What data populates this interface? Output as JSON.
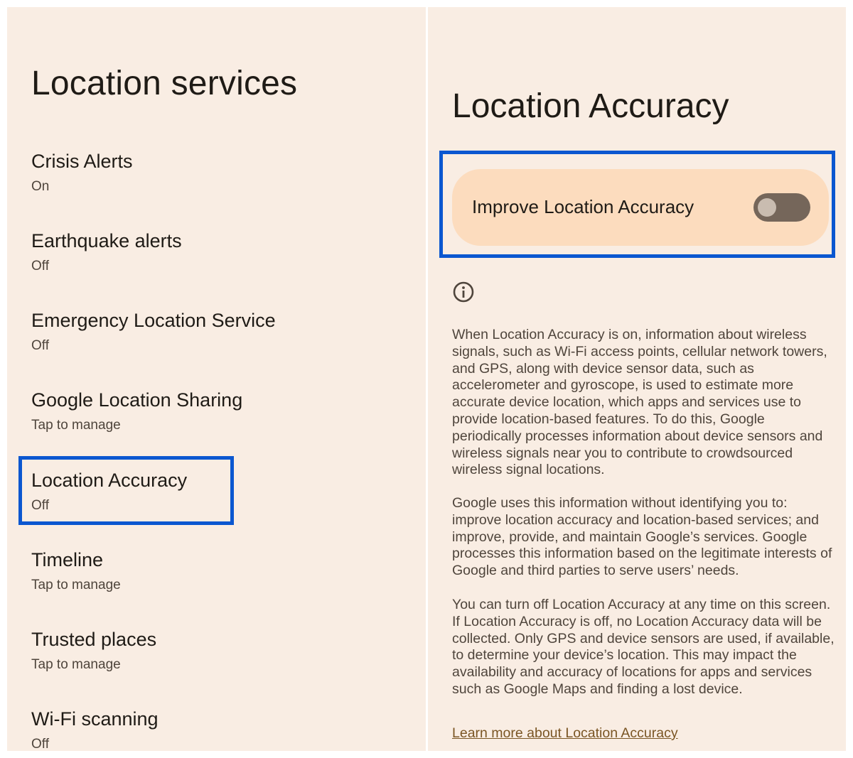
{
  "left_panel": {
    "title": "Location services",
    "items": [
      {
        "title": "Crisis Alerts",
        "subtitle": "On"
      },
      {
        "title": "Earthquake alerts",
        "subtitle": "Off"
      },
      {
        "title": "Emergency Location Service",
        "subtitle": "Off"
      },
      {
        "title": "Google Location Sharing",
        "subtitle": "Tap to manage"
      },
      {
        "title": "Location Accuracy",
        "subtitle": "Off"
      },
      {
        "title": "Timeline",
        "subtitle": "Tap to manage"
      },
      {
        "title": "Trusted places",
        "subtitle": "Tap to manage"
      },
      {
        "title": "Wi-Fi scanning",
        "subtitle": "Off"
      }
    ]
  },
  "right_panel": {
    "title": "Location Accuracy",
    "toggle": {
      "label": "Improve Location Accuracy",
      "state": "off"
    },
    "info_icon": "info-circle-icon",
    "paragraphs": [
      "When Location Accuracy is on, information about wireless signals, such as Wi-Fi access points, cellular network towers, and GPS, along with device sensor data, such as accelerometer and gyroscope, is used to estimate more accurate device location, which apps and services use to provide location-based features. To do this, Google periodically processes information about device sensors and wireless signals near you to contribute to crowdsourced wireless signal locations.",
      "Google uses this information without identifying you to: improve location accuracy and location-based services; and improve, provide, and maintain Google’s services. Google processes this information based on the legitimate interests of Google and third parties to serve users’ needs.",
      "You can turn off Location Accuracy at any time on this screen. If Location Accuracy is off, no Location Accuracy data will be collected. Only GPS and device sensors are used, if available, to determine your device’s location. This may impact the availability and accuracy of locations for apps and services such as Google Maps and finding a lost device."
    ],
    "learn_more": "Learn more about Location Accuracy"
  },
  "colors": {
    "background": "#f9ede3",
    "card": "#fcdcbe",
    "switch_track": "#75665a",
    "highlight": "#0b57d0",
    "link": "#7a5523"
  }
}
